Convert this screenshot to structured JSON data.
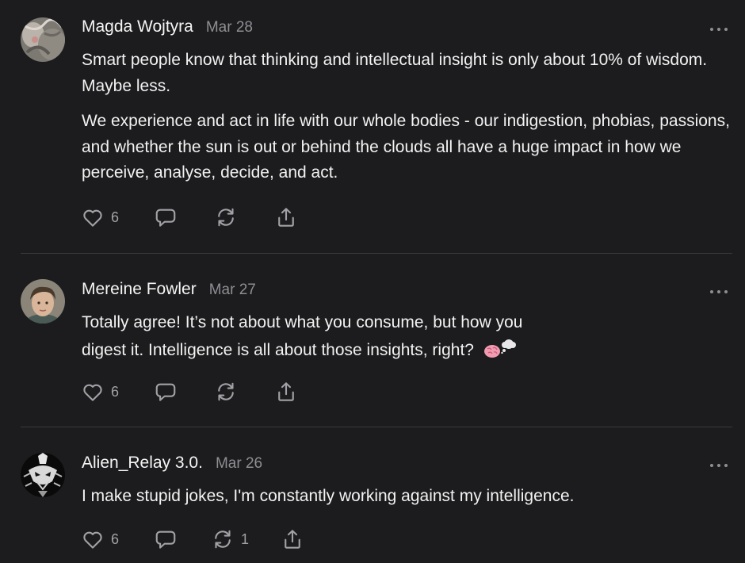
{
  "comments": [
    {
      "author": "Magda Wojtyra",
      "date": "Mar 28",
      "paragraphs": [
        "Smart people know that thinking and intellectual insight is only about 10% of wisdom. Maybe less.",
        "We experience and act in life with our whole bodies - our indigestion, phobias, passions, and whether the sun is out or behind the clouds all have a huge impact in how we perceive, analyse, decide, and act."
      ],
      "likes": "6",
      "restacks": ""
    },
    {
      "author": "Mereine Fowler",
      "date": "Mar 27",
      "paragraphs": [
        "Totally agree! It’s not about what you consume, but how you digest it. Intelligence is all about those insights, right?"
      ],
      "emoji": [
        "brain-emoji",
        "thought-balloon-emoji"
      ],
      "likes": "6",
      "restacks": ""
    },
    {
      "author": "Alien_Relay 3.0.",
      "date": "Mar 26",
      "paragraphs": [
        "I make stupid jokes, I'm constantly working against my intelligence."
      ],
      "likes": "6",
      "restacks": "1"
    }
  ],
  "icons": {
    "like": "heart-icon",
    "reply": "comment-bubble-icon",
    "restack": "restack-icon",
    "share": "share-icon",
    "more": "more-dots-icon"
  },
  "colors": {
    "background": "#1c1c1e",
    "text": "#f2f2f2",
    "muted": "#8e8e93",
    "icon": "#a1a1a6",
    "divider": "#3a3a3c"
  }
}
